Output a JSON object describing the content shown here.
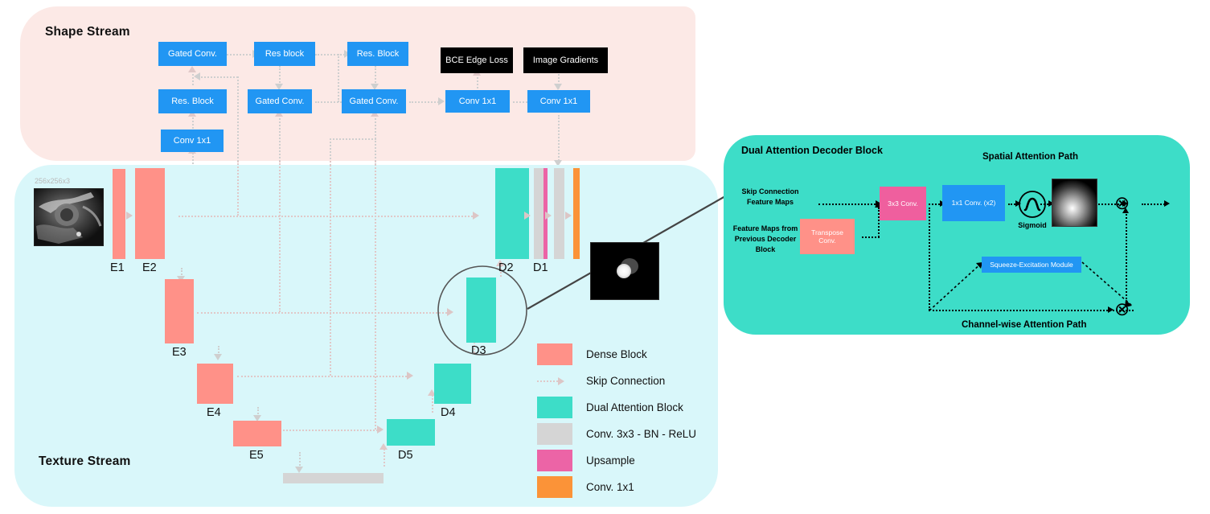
{
  "figure": {
    "shape_stream": {
      "title": "Shape Stream",
      "blocks": [
        {
          "id": "gated-conv-1",
          "label": "Gated Conv."
        },
        {
          "id": "res-block-1",
          "label": "Res block"
        },
        {
          "id": "res-block-2",
          "label": "Res. Block"
        },
        {
          "id": "res-block-3",
          "label": "Res. Block"
        },
        {
          "id": "gated-conv-2",
          "label": "Gated Conv."
        },
        {
          "id": "gated-conv-3",
          "label": "Gated Conv."
        },
        {
          "id": "conv-1x1-a",
          "label": "Conv 1x1"
        },
        {
          "id": "conv-1x1-b",
          "label": "Conv 1x1"
        },
        {
          "id": "conv-1x1-c",
          "label": "Conv 1x1"
        }
      ],
      "loss_blocks": [
        {
          "id": "bce-edge-loss",
          "label": "BCE Edge Loss"
        },
        {
          "id": "image-gradients",
          "label": "Image Gradients"
        }
      ]
    },
    "texture_stream": {
      "title": "Texture Stream",
      "input_size_label": "256x256x3",
      "encoders": [
        {
          "label": "E1"
        },
        {
          "label": "E2"
        },
        {
          "label": "E3"
        },
        {
          "label": "E4"
        },
        {
          "label": "E5"
        }
      ],
      "decoders": [
        {
          "label": "D1"
        },
        {
          "label": "D2"
        },
        {
          "label": "D3"
        },
        {
          "label": "D4"
        },
        {
          "label": "D5"
        }
      ]
    },
    "legend": {
      "items": [
        {
          "label": "Dense Block",
          "color": "#ff9188",
          "type": "swatch"
        },
        {
          "label": "Skip Connection",
          "color": "#e0c8c8",
          "type": "arrow"
        },
        {
          "label": "Dual Attention Block",
          "color": "#3dddc8",
          "type": "swatch"
        },
        {
          "label": "Conv. 3x3 - BN - ReLU",
          "color": "#d5d5d5",
          "type": "swatch"
        },
        {
          "label": "Upsample",
          "color": "#ec64a6",
          "type": "swatch"
        },
        {
          "label": "Conv. 1x1",
          "color": "#fb9338",
          "type": "swatch"
        }
      ]
    },
    "dual_attention_block": {
      "title": "Dual Attention Decoder Block",
      "spatial_path_label": "Spatial Attention Path",
      "channel_path_label": "Channel-wise Attention Path",
      "input_skip_label": "Skip Connection\nFeature Maps",
      "input_skip_line1": "Skip Connection",
      "input_skip_line2": "Feature Maps",
      "input_prev_line1": "Feature Maps from",
      "input_prev_line2": "Previous Decoder",
      "input_prev_line3": "Block",
      "transpose_conv_label": "Transpose\nConv.",
      "transpose_conv_line1": "Transpose",
      "transpose_conv_line2": "Conv.",
      "conv3x3_label": "3x3 Conv.",
      "conv1x1_label": "1x1 Conv. (x2)",
      "sigmoid_label": "Sigmoid",
      "se_module_label": "Squeeze-Excitation Module",
      "multiply_symbol": "⊗"
    },
    "colors": {
      "shape_panel": "#fce9e6",
      "texture_panel": "#d9f7fa",
      "dab_panel": "#3dddc8",
      "blue_box": "#2196f3",
      "dense_block": "#ff9188",
      "dual_attention": "#3dddc8",
      "conv_bn_relu": "#d5d5d5",
      "upsample": "#ec64a6",
      "conv1x1": "#fb9338",
      "pink_conv": "#ef5f9e",
      "black_box": "#000000"
    }
  }
}
